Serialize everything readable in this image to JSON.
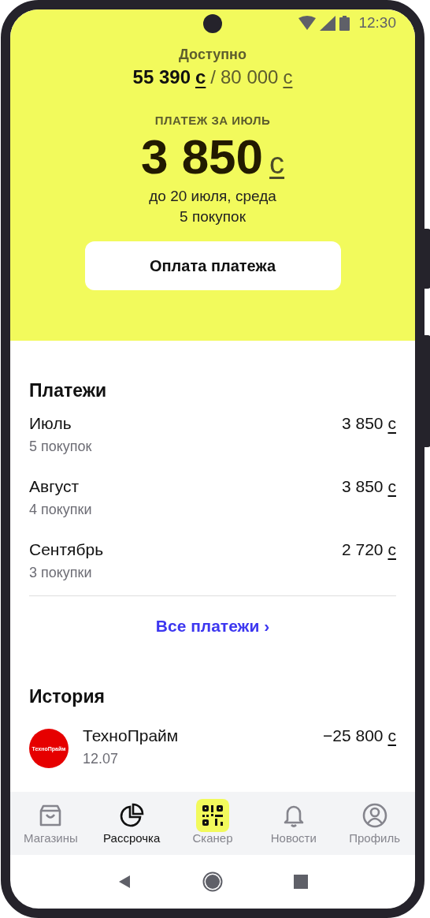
{
  "status_bar": {
    "time": "12:30"
  },
  "summary": {
    "label": "Доступно",
    "available": "55 390",
    "available_currency": "с",
    "separator": "/",
    "limit": "80 000",
    "limit_currency": "с"
  },
  "next_payment": {
    "label": "ПЛАТЕЖ ЗА ИЮЛЬ",
    "amount": "3 850",
    "currency": "с",
    "due": "до 20 июля, среда",
    "purchases": "5 покупок",
    "button": "Оплата платежа"
  },
  "payments": {
    "title": "Платежи",
    "rows": [
      {
        "month": "Июль",
        "purchases": "5 покупок",
        "amount": "3 850",
        "currency": "с"
      },
      {
        "month": "Август",
        "purchases": "4 покупки",
        "amount": "3 850",
        "currency": "с"
      },
      {
        "month": "Сентябрь",
        "purchases": "3 покупки",
        "amount": "2 720",
        "currency": "с"
      }
    ],
    "link": "Все платежи",
    "link_arrow": "›"
  },
  "history": {
    "title": "История",
    "items": [
      {
        "logo_text": "ТехноПрайм",
        "color": "#e60000",
        "name": "ТехноПрайм",
        "date": "12.07",
        "amount": "−25 800",
        "currency": "с"
      }
    ]
  },
  "tabs": [
    {
      "kind": "bag",
      "label": "Магазины",
      "selected": false
    },
    {
      "kind": "pie",
      "label": "Рассрочка",
      "selected": true
    },
    {
      "kind": "qr",
      "label": "Сканер",
      "selected": false
    },
    {
      "kind": "bell",
      "label": "Новости",
      "selected": false
    },
    {
      "kind": "person",
      "label": "Профиль",
      "selected": false
    }
  ]
}
